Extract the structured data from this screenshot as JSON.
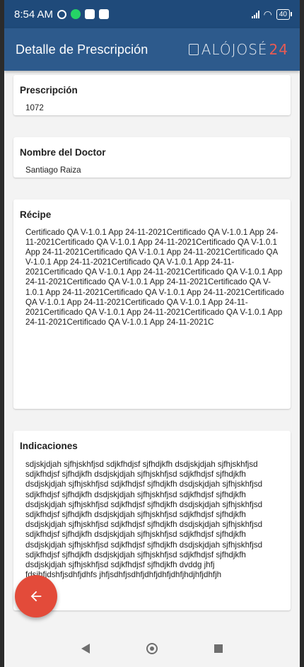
{
  "status_bar": {
    "time": "8:54 AM",
    "battery": "40"
  },
  "app_bar": {
    "title": "Detalle de Prescripción",
    "logo_text": "ALÓJOSÉ",
    "logo_number": "24"
  },
  "cards": {
    "prescripcion": {
      "label": "Prescripción",
      "value": "1072"
    },
    "doctor": {
      "label": "Nombre del Doctor",
      "value": "Santiago Raiza"
    },
    "recipe": {
      "label": "Récipe",
      "value": "Certificado QA V-1.0.1 App 24-11-2021Certificado QA V-1.0.1 App 24-11-2021Certificado QA V-1.0.1 App 24-11-2021Certificado QA V-1.0.1 App 24-11-2021Certificado QA V-1.0.1 App 24-11-2021Certificado QA V-1.0.1 App 24-11-2021Certificado QA V-1.0.1 App 24-11-2021Certificado QA V-1.0.1 App 24-11-2021Certificado QA V-1.0.1 App 24-11-2021Certificado QA V-1.0.1 App 24-11-2021Certificado QA V-1.0.1 App 24-11-2021Certificado QA V-1.0.1 App 24-11-2021Certificado QA V-1.0.1 App 24-11-2021Certificado QA V-1.0.1 App 24-11-2021Certificado QA V-1.0.1 App 24-11-2021Certificado QA V-1.0.1 App 24-11-2021Certificado QA V-1.0.1 App 24-11-2021C"
    },
    "indicaciones": {
      "label": "Indicaciones",
      "value": "sdjskjdjah sjfhjskhfjsd sdjkfhdjsf sjfhdjkfh dsdjskjdjah sjfhjskhfjsd sdjkfhdjsf sjfhdjkfh dsdjskjdjah sjfhjskhfjsd sdjkfhdjsf sjfhdjkfh dsdjskjdjah sjfhjskhfjsd sdjkfhdjsf sjfhdjkfh dsdjskjdjah sjfhjskhfjsd sdjkfhdjsf sjfhdjkfh dsdjskjdjah sjfhjskhfjsd sdjkfhdjsf sjfhdjkfh dsdjskjdjah sjfhjskhfjsd sdjkfhdjsf sjfhdjkfh dsdjskjdjah sjfhjskhfjsd sdjkfhdjsf sjfhdjkfh dsdjskjdjah sjfhjskhfjsd sdjkfhdjsf sjfhdjkfh dsdjskjdjah sjfhjskhfjsd sdjkfhdjsf sjfhdjkfh dsdjskjdjah sjfhjskhfjsd sdjkfhdjsf sjfhdjkfh dsdjskjdjah sjfhjskhfjsd sdjkfhdjsf sjfhdjkfh dsdjskjdjah sjfhjskhfjsd sdjkfhdjsf sjfhdjkfh dsdjskjdjah sjfhjskhfjsd sdjkfhdjsf sjfhdjkfh dsdjskjdjah sjfhjskhfjsd sdjkfhdjsf sjfhdjkfh dsdjskjdjah sjfhjskhfjsd sdjkfhdjsf sjfhdjkfh dvddg jhfj fdsjhfjdshfjsdhfjdhfs jhfjsdhfjsdhfjdhfjdhfjdhfjhdjhfjdhfjh"
    }
  },
  "fab": {
    "icon": "arrow-left-icon",
    "color": "#e34b3a"
  },
  "colors": {
    "status_bar": "#1f4a7a",
    "app_bar": "#2d5a8c",
    "background": "#f3f3f3"
  }
}
